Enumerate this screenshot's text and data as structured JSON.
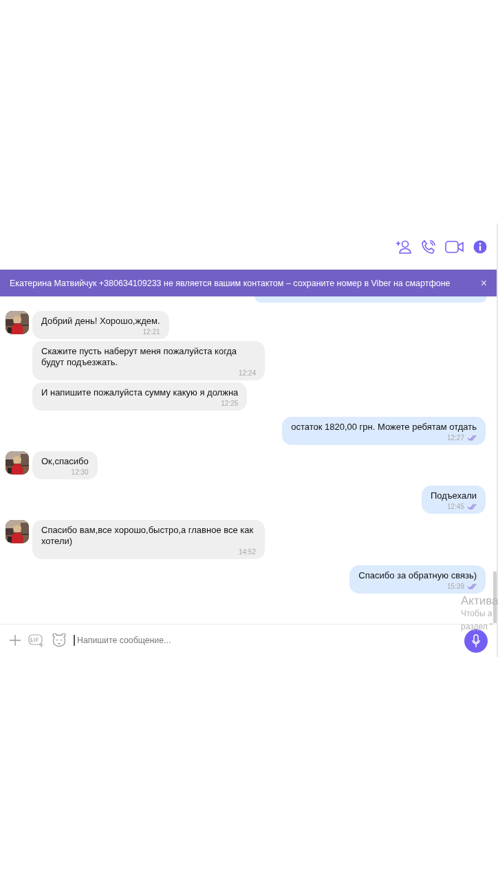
{
  "banner": {
    "text": "Екатерина Матвийчук +380634109233 не является вашим контактом – сохраните номер в Viber на смартфоне",
    "close": "×"
  },
  "messages": [
    {
      "kind": "incoming",
      "show_avatar": true,
      "text": "Добрий день! Хорошо,ждем.",
      "time": "12:21"
    },
    {
      "kind": "incoming",
      "show_avatar": false,
      "text": "Скажите пусть наберут меня пожалуйста когда будут подъезжать.",
      "time": "12:24"
    },
    {
      "kind": "incoming",
      "show_avatar": false,
      "text": "И напишите пожалуйста сумму какую я должна",
      "time": "12:25"
    },
    {
      "kind": "outgoing",
      "read": true,
      "text": "остаток 1820,00 грн. Можете ребятам отдать",
      "time": "12:27"
    },
    {
      "kind": "incoming",
      "show_avatar": true,
      "text": "Ок,спасибо",
      "time": "12:30"
    },
    {
      "kind": "outgoing",
      "read": true,
      "text": "Подъехали",
      "time": "12:45"
    },
    {
      "kind": "incoming",
      "show_avatar": true,
      "text": "Спасибо вам,все хорошо,быстро,а главное все как хотели)",
      "time": "14:52"
    },
    {
      "kind": "outgoing",
      "read": true,
      "text": "Спасибо за обратную связь)",
      "time": "15:39"
    }
  ],
  "composer": {
    "placeholder": "Напишите сообщение..."
  },
  "activation_notice": {
    "title": "Актива",
    "lines": [
      "Чтобы а",
      "раздел \""
    ]
  }
}
